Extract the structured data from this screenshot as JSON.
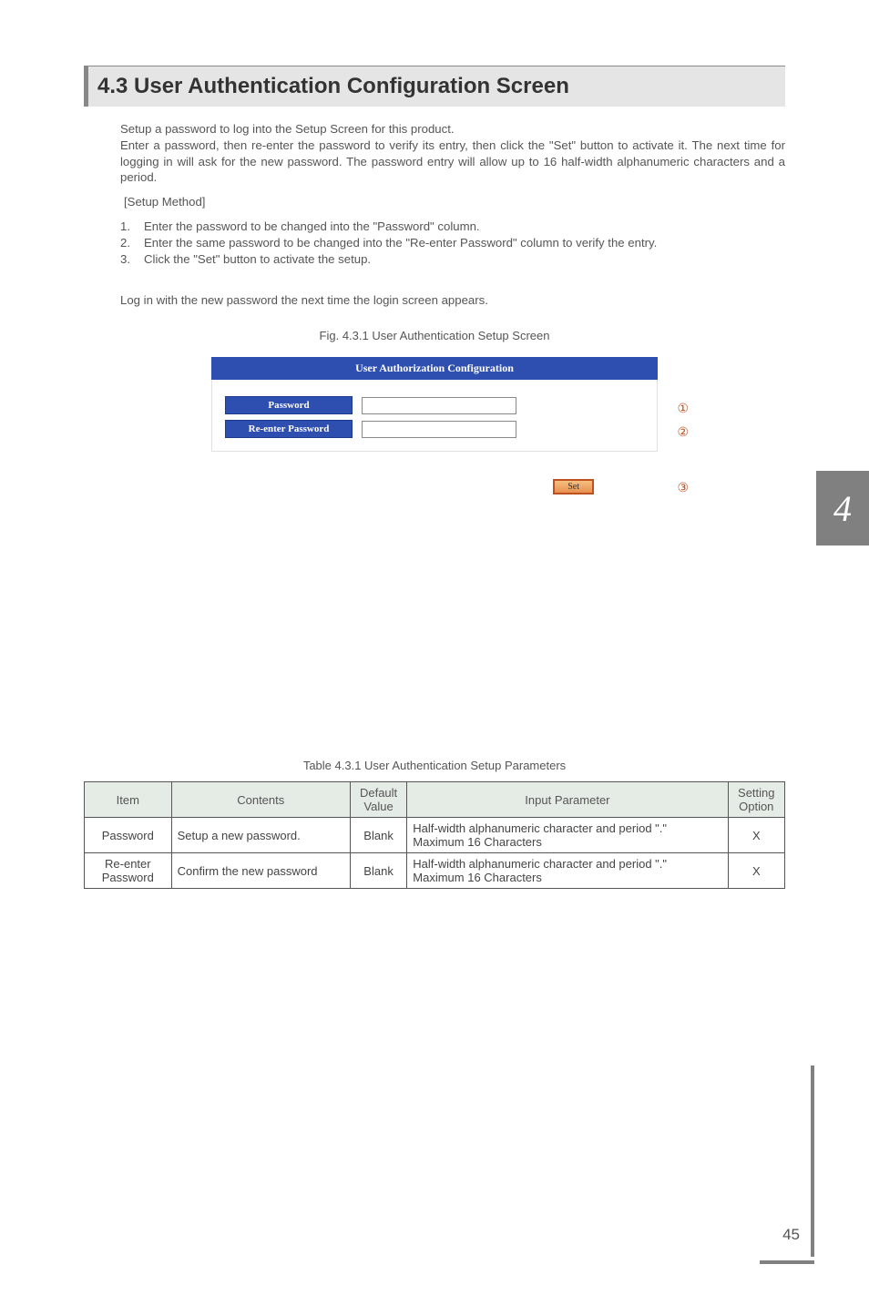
{
  "section": {
    "title": "4.3 User Authentication Configuration Screen"
  },
  "intro": {
    "p1": "Setup a password to log into the Setup Screen for this product.",
    "p2": "Enter a password, then re-enter the password to verify its entry, then click the \"Set\" button to activate it.  The next time for logging in will ask for the new password.  The password entry will allow up to 16 half-width alphanumeric characters and a period."
  },
  "setup_method_label": "[Setup Method]",
  "steps": [
    {
      "num": "1.",
      "text": "Enter the password to be changed into the \"Password\" column."
    },
    {
      "num": "2.",
      "text": "Enter the same password to be changed into the \"Re-enter Password\" column to verify the entry."
    },
    {
      "num": "3.",
      "text": "Click the \"Set\" button to activate the setup."
    }
  ],
  "after_steps": "Log in with the new password the next time the login screen appears.",
  "fig_caption": "Fig. 4.3.1 User Authentication Setup Screen",
  "screenshot": {
    "panel_title": "User Authorization Configuration",
    "password_label": "Password",
    "reenter_label": "Re-enter Password",
    "set_label": "Set",
    "callouts": {
      "c1": "①",
      "c2": "②",
      "c3": "③"
    }
  },
  "section_tab": "4",
  "table_caption": "Table 4.3.1 User Authentication Setup Parameters",
  "table_header": {
    "item": "Item",
    "contents": "Contents",
    "default": "Default Value",
    "input": "Input Parameter",
    "setting": "Setting Option"
  },
  "table_rows": [
    {
      "item": "Password",
      "contents": "Setup a new password.",
      "default": "Blank",
      "input": "Half-width alphanumeric character and period \".\"\nMaximum 16 Characters",
      "setting": "X"
    },
    {
      "item": "Re-enter Password",
      "contents": "Confirm the new password",
      "default": "Blank",
      "input": "Half-width alphanumeric character and period \".\"\nMaximum 16 Characters",
      "setting": "X"
    }
  ],
  "page_number": "45"
}
